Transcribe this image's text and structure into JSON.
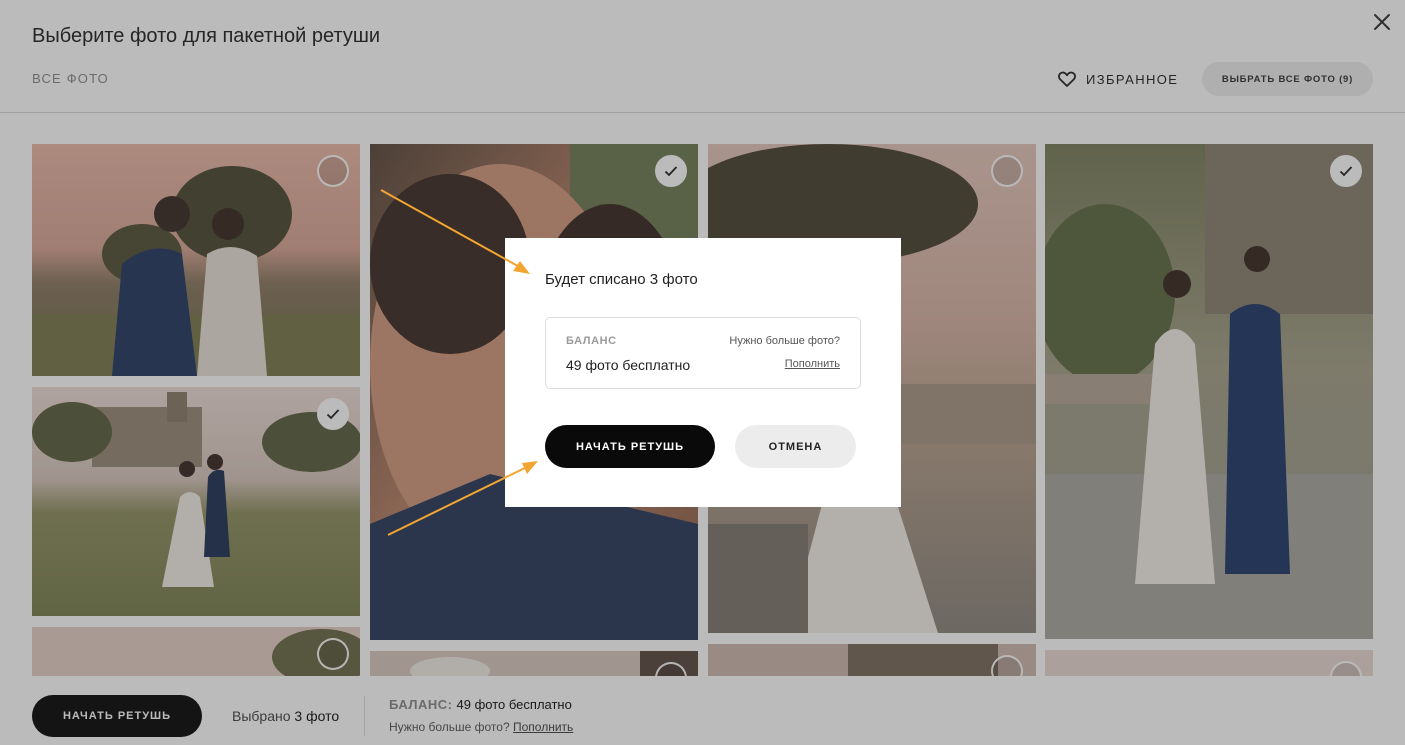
{
  "header": {
    "title": "Выберите фото для пакетной ретуши",
    "tab_all": "ВСЕ ФОТО",
    "favorites_label": "ИЗБРАННОЕ",
    "select_all_label": "ВЫБРАТЬ ВСЕ ФОТО (9)",
    "close_icon": "close-icon"
  },
  "photos": [
    {
      "scene": "couple-sunset-back",
      "selected": false
    },
    {
      "scene": "couple-castle-field",
      "selected": true
    },
    {
      "scene": "partial-sky",
      "selected": false
    },
    {
      "scene": "closeup-embrace",
      "selected": true
    },
    {
      "scene": "partial-dress-detail",
      "selected": false
    },
    {
      "scene": "dress-terrace-tree",
      "selected": false
    },
    {
      "scene": "partial-rocks",
      "selected": false
    },
    {
      "scene": "couple-walking-lights",
      "selected": true
    },
    {
      "scene": "partial-pale",
      "selected": false
    }
  ],
  "modal": {
    "title": "Будет списано 3 фото",
    "balance_label": "БАЛАНС",
    "balance_value": "49 фото бесплатно",
    "need_more": "Нужно больше фото?",
    "topup": "Пополнить",
    "start_label": "НАЧАТЬ РЕТУШЬ",
    "cancel_label": "ОТМЕНА"
  },
  "bottom_bar": {
    "start_label": "НАЧАТЬ РЕТУШЬ",
    "selected_prefix": "Выбрано",
    "selected_count": "3 фото",
    "balance_key": "БАЛАНС:",
    "balance_value": "49 фото бесплатно",
    "need_more": "Нужно больше фото?",
    "topup": "Пополнить"
  },
  "colors": {
    "accent_arrow": "#f2a531",
    "primary_button": "#0a0a0a",
    "overlay": "rgba(45,45,45,0.32)"
  }
}
